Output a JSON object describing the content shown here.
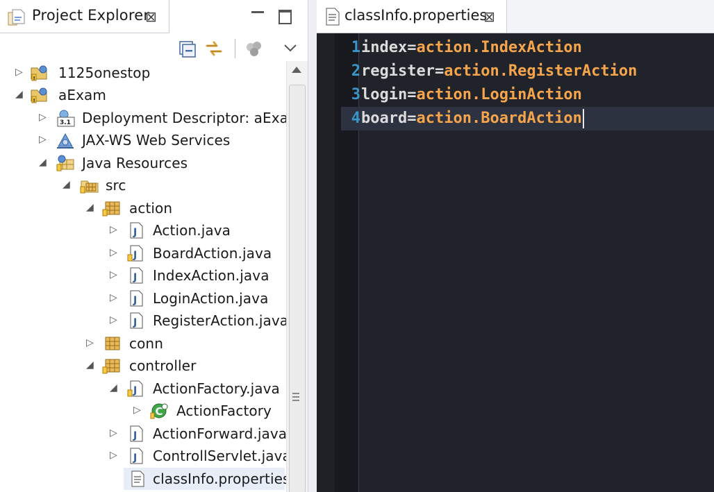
{
  "project_explorer": {
    "tab_title": "Project Explorer",
    "close_glyph": "⊠",
    "toolbar": {
      "collapse_all_icon": "collapse-all-icon",
      "link_with_editor_icon": "link-with-editor-icon",
      "filter_icon": "filter-icon",
      "view_menu_icon": "view-menu-icon"
    },
    "tree": [
      {
        "label": "1125onestop",
        "icon": "project-icon",
        "expanded": false
      },
      {
        "label": "aExam",
        "icon": "project-icon",
        "expanded": true
      },
      {
        "label": "Deployment Descriptor: aExam",
        "icon": "deployment-descriptor-icon",
        "expanded": false
      },
      {
        "label": "JAX-WS Web Services",
        "icon": "web-services-icon",
        "expanded": false
      },
      {
        "label": "Java Resources",
        "icon": "java-resources-icon",
        "expanded": true
      },
      {
        "label": "src",
        "icon": "source-folder-icon",
        "expanded": true
      },
      {
        "label": "action",
        "icon": "package-icon",
        "expanded": true
      },
      {
        "label": "Action.java",
        "icon": "java-file-icon",
        "expanded": false
      },
      {
        "label": "BoardAction.java",
        "icon": "java-file-icon",
        "expanded": false
      },
      {
        "label": "IndexAction.java",
        "icon": "java-file-icon",
        "expanded": false
      },
      {
        "label": "LoginAction.java",
        "icon": "java-file-icon",
        "expanded": false
      },
      {
        "label": "RegisterAction.java",
        "icon": "java-file-icon",
        "expanded": false
      },
      {
        "label": "conn",
        "icon": "package-icon",
        "expanded": false
      },
      {
        "label": "controller",
        "icon": "package-icon",
        "expanded": true
      },
      {
        "label": "ActionFactory.java",
        "icon": "java-file-icon",
        "expanded": true
      },
      {
        "label": "ActionFactory",
        "icon": "class-icon",
        "expanded": false
      },
      {
        "label": "ActionForward.java",
        "icon": "java-file-icon",
        "expanded": false
      },
      {
        "label": "ControllServlet.java",
        "icon": "java-file-icon",
        "expanded": false
      },
      {
        "label": "classInfo.properties",
        "icon": "properties-file-icon",
        "selected": true
      }
    ]
  },
  "editor": {
    "tab_title": "classInfo.properties",
    "close_glyph": "⊠",
    "lines": [
      {
        "number": "1",
        "key": "index=",
        "value": "action.IndexAction"
      },
      {
        "number": "2",
        "key": "register=",
        "value": "action.RegisterAction"
      },
      {
        "number": "3",
        "key": "login=",
        "value": "action.LoginAction"
      },
      {
        "number": "4",
        "key": "board=",
        "value": "action.BoardAction",
        "current": true
      }
    ]
  },
  "colors": {
    "editor_background": "#20232a",
    "line_number": "#3a95c9",
    "property_key": "#dcdcdc",
    "property_value": "#f6a54c",
    "current_line": "#2c3240"
  }
}
